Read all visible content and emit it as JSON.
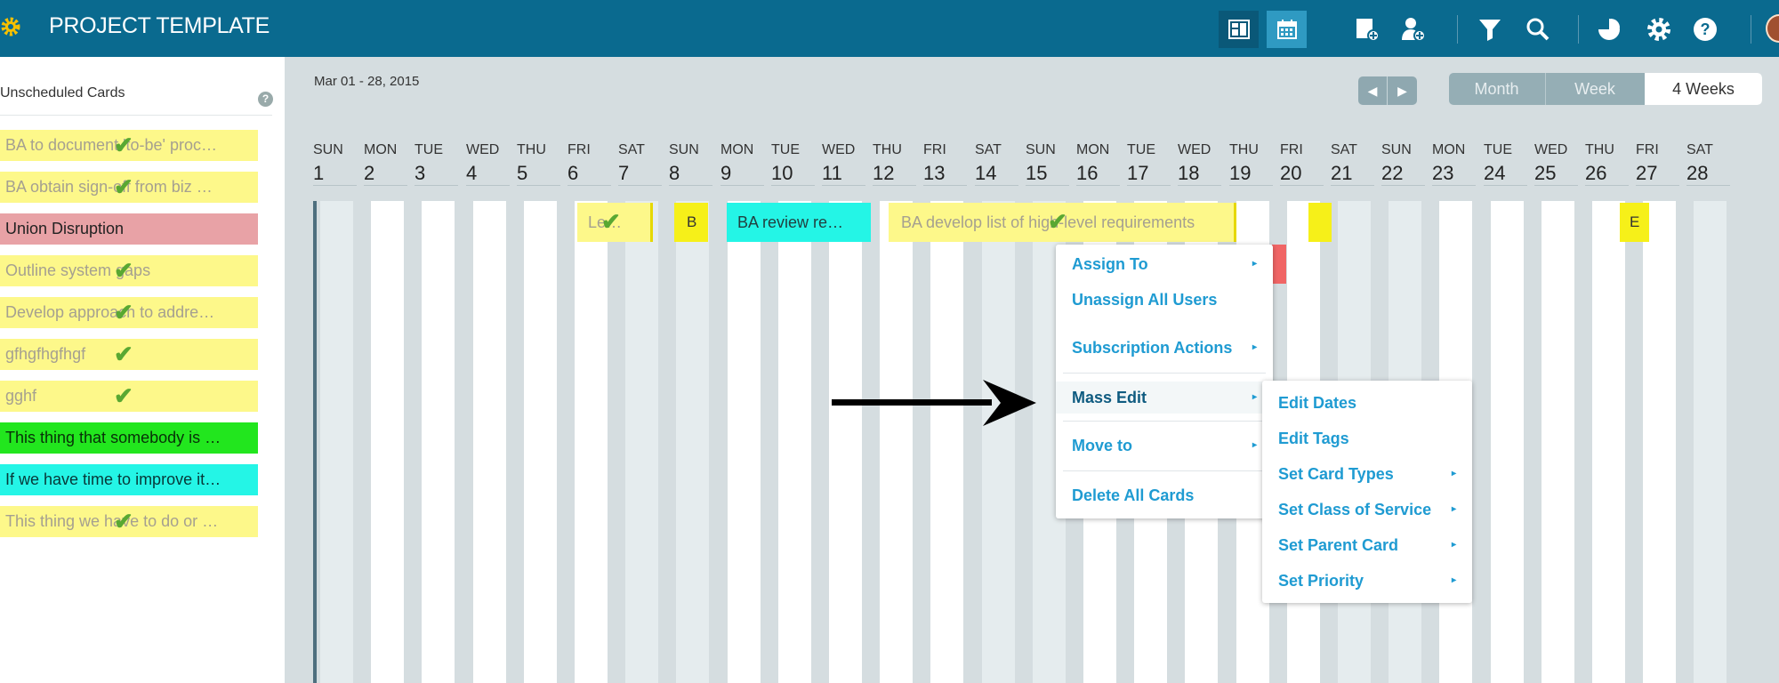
{
  "header": {
    "title": "PROJECT TEMPLATE"
  },
  "sidebar": {
    "title": "Unscheduled Cards",
    "help": "?",
    "cards": [
      {
        "label": "BA to document 'to-be' proc…",
        "color": "#fdf88a",
        "text_color": "#a5a090",
        "checked": true
      },
      {
        "label": "BA obtain sign-off from biz …",
        "color": "#fdf88a",
        "text_color": "#a5a090",
        "checked": true
      },
      {
        "label": "Union Disruption",
        "color": "#e8a2a6",
        "text_color": "#222222",
        "checked": false
      },
      {
        "label": "Outline system gaps",
        "color": "#fdf88a",
        "text_color": "#a5a090",
        "checked": true
      },
      {
        "label": "Develop approach to addre…",
        "color": "#fdf88a",
        "text_color": "#a5a090",
        "checked": true
      },
      {
        "label": "gfhgfhgfhgf",
        "color": "#fdf88a",
        "text_color": "#a5a090",
        "checked": true
      },
      {
        "label": "gghf",
        "color": "#fdf88a",
        "text_color": "#a5a090",
        "checked": true
      },
      {
        "label": "This thing that somebody is …",
        "color": "#22e61e",
        "text_color": "#083008",
        "checked": false
      },
      {
        "label": "If we have time to improve it…",
        "color": "#24f5e6",
        "text_color": "#083838",
        "checked": false
      },
      {
        "label": "This thing we have to do or …",
        "color": "#fdf88a",
        "text_color": "#a5a090",
        "checked": true
      }
    ]
  },
  "calendar": {
    "date_range": "Mar 01 - 28, 2015",
    "nav": {
      "prev": "◀",
      "next": "▶"
    },
    "views": [
      "Month",
      "Week",
      "4 Weeks"
    ],
    "active_view": "4 Weeks",
    "days": [
      {
        "dow": "SUN",
        "num": "1"
      },
      {
        "dow": "MON",
        "num": "2"
      },
      {
        "dow": "TUE",
        "num": "3"
      },
      {
        "dow": "WED",
        "num": "4"
      },
      {
        "dow": "THU",
        "num": "5"
      },
      {
        "dow": "FRI",
        "num": "6"
      },
      {
        "dow": "SAT",
        "num": "7"
      },
      {
        "dow": "SUN",
        "num": "8"
      },
      {
        "dow": "MON",
        "num": "9"
      },
      {
        "dow": "TUE",
        "num": "10"
      },
      {
        "dow": "WED",
        "num": "11"
      },
      {
        "dow": "THU",
        "num": "12"
      },
      {
        "dow": "FRI",
        "num": "13"
      },
      {
        "dow": "SAT",
        "num": "14"
      },
      {
        "dow": "SUN",
        "num": "15"
      },
      {
        "dow": "MON",
        "num": "16"
      },
      {
        "dow": "TUE",
        "num": "17"
      },
      {
        "dow": "WED",
        "num": "18"
      },
      {
        "dow": "THU",
        "num": "19"
      },
      {
        "dow": "FRI",
        "num": "20"
      },
      {
        "dow": "SAT",
        "num": "21"
      },
      {
        "dow": "SUN",
        "num": "22"
      },
      {
        "dow": "MON",
        "num": "23"
      },
      {
        "dow": "TUE",
        "num": "24"
      },
      {
        "dow": "WED",
        "num": "25"
      },
      {
        "dow": "THU",
        "num": "26"
      },
      {
        "dow": "FRI",
        "num": "27"
      },
      {
        "dow": "SAT",
        "num": "28"
      }
    ],
    "bars": {
      "l": "Le…",
      "b": "B",
      "ba_review": "BA review re…",
      "ba_develop": "BA develop list of high-level requirements",
      "e": "E"
    }
  },
  "context_menu": {
    "items": [
      "Assign To",
      "Unassign All Users",
      "Subscription Actions",
      "Mass Edit",
      "Move to",
      "Delete All Cards"
    ]
  },
  "submenu": {
    "items": [
      "Edit Dates",
      "Edit Tags",
      "Set Card Types",
      "Set Class of Service",
      "Set Parent Card",
      "Set Priority"
    ]
  },
  "icons": {
    "submenu_arrow": "▸",
    "check": "✔"
  },
  "colors": {
    "header": "#0a6a8f",
    "menu_text": "#1f9bd2",
    "card_yellow": "#fdf88a"
  }
}
